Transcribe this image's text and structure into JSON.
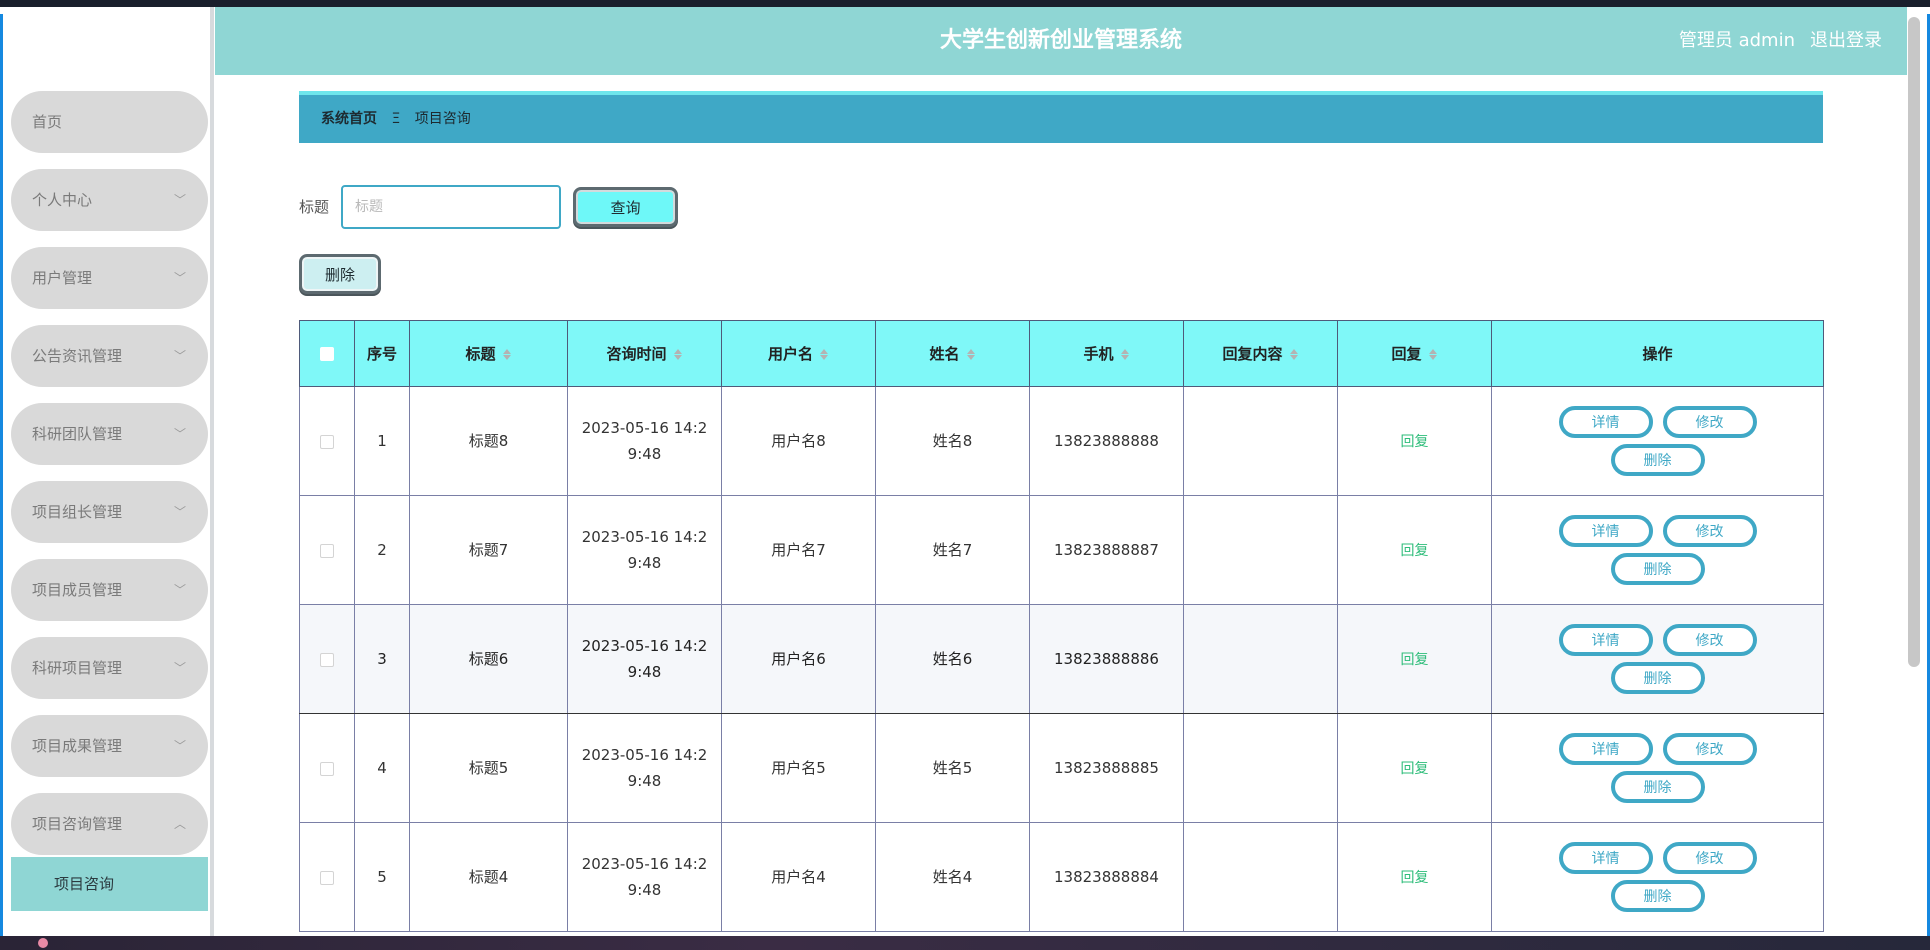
{
  "header": {
    "title": "大学生创新创业管理系统",
    "user": "管理员 admin",
    "logout": "退出登录"
  },
  "sidebar": {
    "items": [
      {
        "label": "首页",
        "chevron": ""
      },
      {
        "label": "个人中心",
        "chevron": "﹀"
      },
      {
        "label": "用户管理",
        "chevron": "﹀"
      },
      {
        "label": "公告资讯管理",
        "chevron": "﹀"
      },
      {
        "label": "科研团队管理",
        "chevron": "﹀"
      },
      {
        "label": "项目组长管理",
        "chevron": "﹀"
      },
      {
        "label": "项目成员管理",
        "chevron": "﹀"
      },
      {
        "label": "科研项目管理",
        "chevron": "﹀"
      },
      {
        "label": "项目成果管理",
        "chevron": "﹀"
      },
      {
        "label": "项目咨询管理",
        "chevron": "︿"
      }
    ],
    "sub_item": "项目咨询"
  },
  "breadcrumb": {
    "home": "系统首页",
    "separator": "Ξ",
    "current": "项目咨询"
  },
  "search": {
    "label": "标题",
    "placeholder": "标题",
    "value": "",
    "button": "查询"
  },
  "actions": {
    "batch_delete": "删除"
  },
  "table": {
    "headers": [
      "序号",
      "标题",
      "咨询时间",
      "用户名",
      "姓名",
      "手机",
      "回复内容",
      "回复",
      "操作"
    ],
    "rows": [
      {
        "no": "1",
        "title": "标题8",
        "time1": "2023-05-16 14:2",
        "time2": "9:48",
        "username": "用户名8",
        "name": "姓名8",
        "phone": "13823888888",
        "reply_content": "",
        "reply": "回复"
      },
      {
        "no": "2",
        "title": "标题7",
        "time1": "2023-05-16 14:2",
        "time2": "9:48",
        "username": "用户名7",
        "name": "姓名7",
        "phone": "13823888887",
        "reply_content": "",
        "reply": "回复"
      },
      {
        "no": "3",
        "title": "标题6",
        "time1": "2023-05-16 14:2",
        "time2": "9:48",
        "username": "用户名6",
        "name": "姓名6",
        "phone": "13823888886",
        "reply_content": "",
        "reply": "回复"
      },
      {
        "no": "4",
        "title": "标题5",
        "time1": "2023-05-16 14:2",
        "time2": "9:48",
        "username": "用户名5",
        "name": "姓名5",
        "phone": "13823888885",
        "reply_content": "",
        "reply": "回复"
      },
      {
        "no": "5",
        "title": "标题4",
        "time1": "2023-05-16 14:2",
        "time2": "9:48",
        "username": "用户名4",
        "name": "姓名4",
        "phone": "13823888884",
        "reply_content": "",
        "reply": "回复"
      }
    ],
    "row_actions": {
      "detail": "详情",
      "edit": "修改",
      "delete": "删除"
    }
  },
  "colors": {
    "header_bg": "#8fd6d4",
    "breadcrumb_bg": "#3fa8c6",
    "table_header_bg": "#7ff8f8",
    "accent": "#3fa8c6",
    "reply_link": "#2ebd7a"
  }
}
